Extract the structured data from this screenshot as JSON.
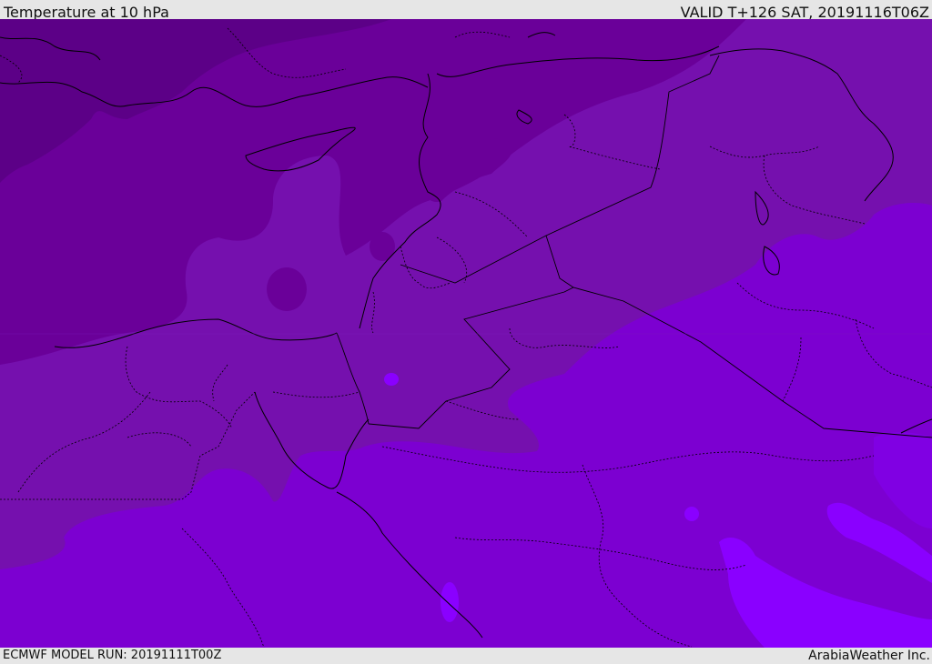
{
  "header": {
    "title": "Temperature at 10 hPa",
    "valid_time": "VALID T+126 SAT, 20191116T06Z"
  },
  "footer": {
    "model_run": "ECMWF MODEL RUN: 20191111T00Z",
    "credit": "ArabiaWeather Inc."
  },
  "map": {
    "shading_colors": {
      "darkest": "#5c0087",
      "dark": "#6a0099",
      "mid": "#7510ae",
      "light": "#7c00d1",
      "lighter": "#8000e3",
      "lightest": "#8a00ff"
    },
    "coastline_color": "#000000",
    "border_style": "dotted"
  }
}
